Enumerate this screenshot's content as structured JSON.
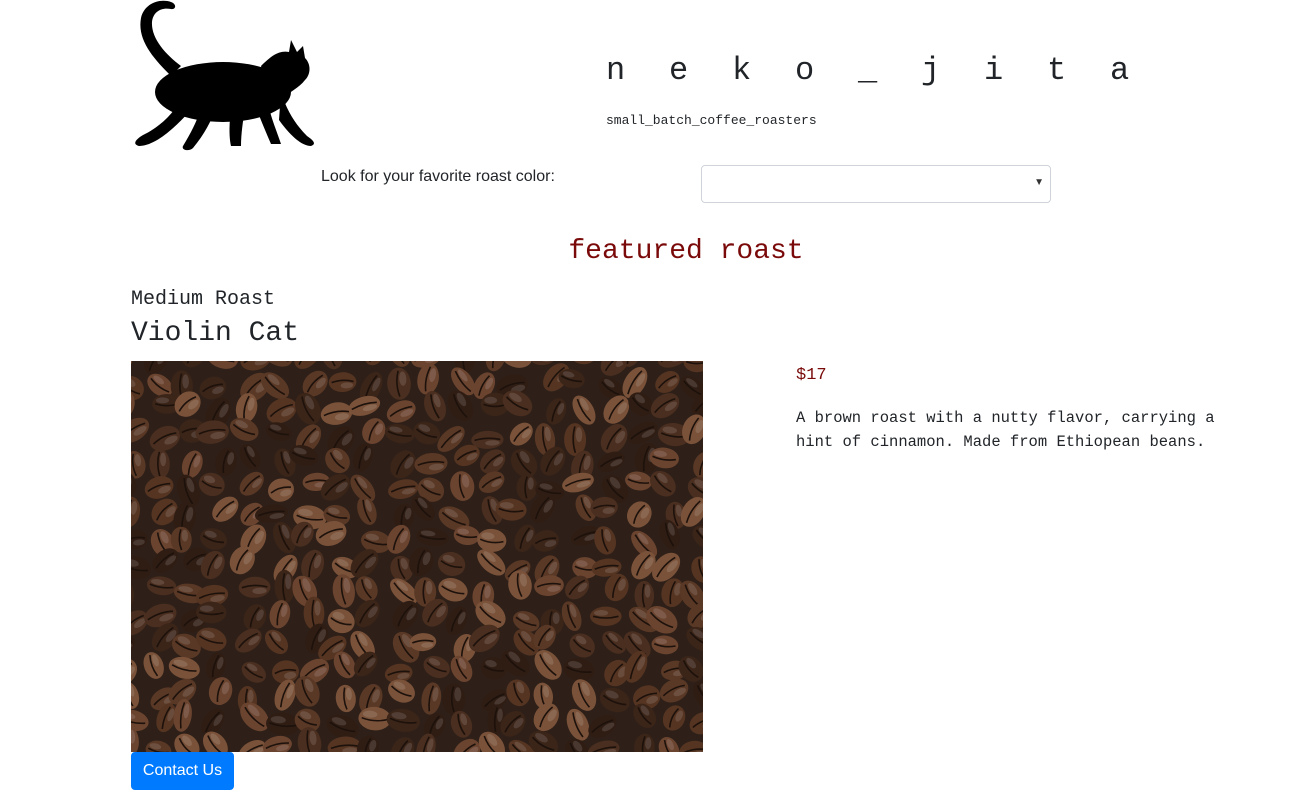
{
  "brand": {
    "logo_icon": "cat-silhouette-icon",
    "title": "n e k o _ j i t a",
    "tagline": "small_batch_coffee_roasters"
  },
  "filter": {
    "label": "Look for your favorite roast color:",
    "selected_value": ""
  },
  "featured": {
    "heading": "featured roast",
    "roast_type": "Medium Roast",
    "name": "Violin Cat",
    "image_subject": "coffee-beans",
    "price": "$17",
    "description": "A brown roast with a nutty flavor, carrying a hint of cinnamon. Made from Ethiopean beans."
  },
  "contact_button": {
    "label": "Contact Us"
  },
  "colors": {
    "accent": "#7a0a0a",
    "button": "#007bff",
    "text": "#212529"
  }
}
